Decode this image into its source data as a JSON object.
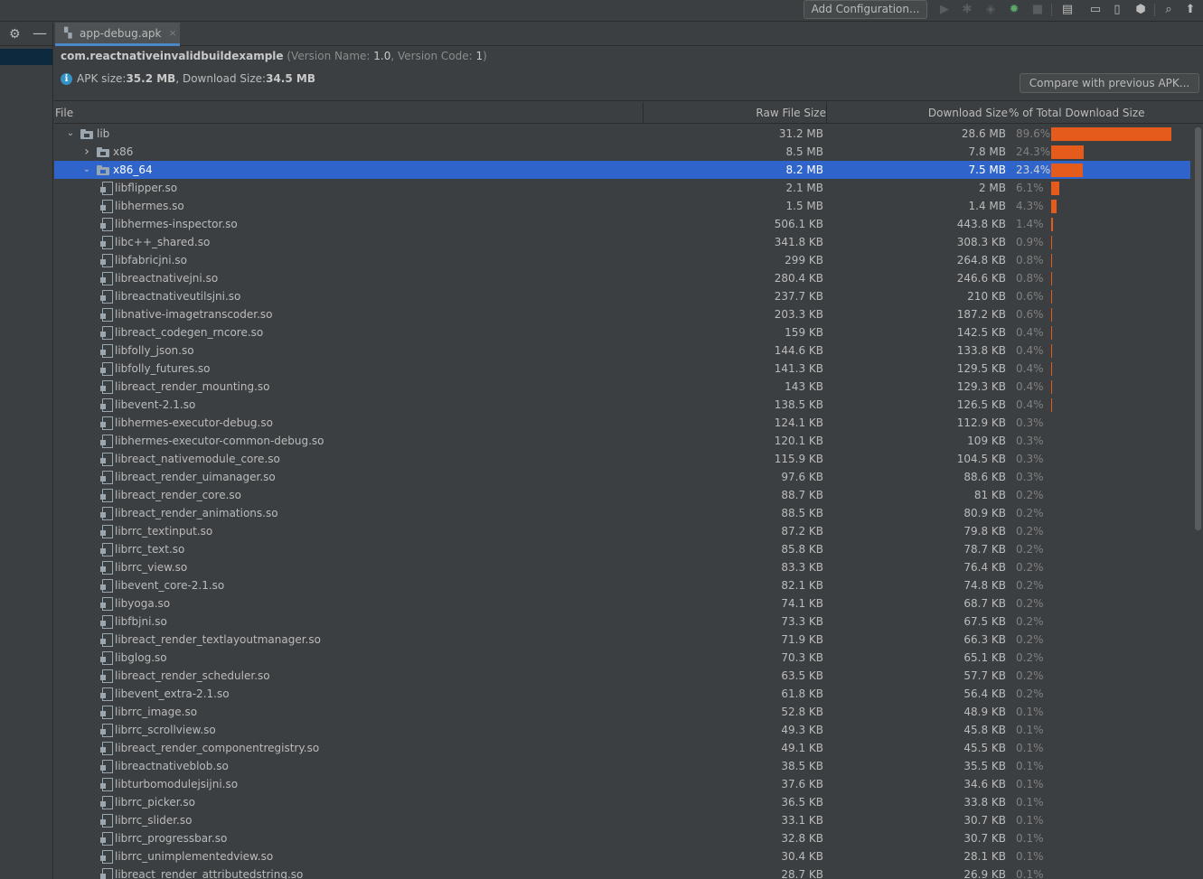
{
  "toolbar": {
    "add_configuration_label": "Add Configuration...",
    "icons": [
      "run-icon",
      "debug-icon",
      "coverage-icon",
      "profile-icon",
      "stop-icon",
      "project-structure-icon",
      "terminal-icon",
      "device-manager-icon",
      "sdk-manager-icon",
      "search-icon",
      "updates-icon"
    ]
  },
  "tab": {
    "label": "app-debug.apk",
    "close": "×"
  },
  "info": {
    "package_name": "com.reactnativeinvalidbuildexample",
    "version_prefix": "(Version Name: ",
    "version_name": "1.0",
    "version_mid": ", Version Code: ",
    "version_code": "1",
    "version_suffix": ")",
    "apk_size_label": "APK size: ",
    "apk_size": "35.2 MB",
    "download_size_label": ", Download Size: ",
    "download_size": "34.5 MB",
    "compare_button": "Compare with previous APK..."
  },
  "table": {
    "columns": {
      "file": "File",
      "raw_size": "Raw File Size",
      "download_size": "Download Size",
      "percent": "% of Total Download Size"
    },
    "rows": [
      {
        "name": "lib",
        "type": "folder",
        "level": 0,
        "expanded": true,
        "raw": "31.2 MB",
        "download": "28.6 MB",
        "percent": "89.6%",
        "fraction": 0.896
      },
      {
        "name": "x86",
        "type": "folder",
        "level": 1,
        "expanded": false,
        "raw": "8.5 MB",
        "download": "7.8 MB",
        "percent": "24.3%",
        "fraction": 0.243
      },
      {
        "name": "x86_64",
        "type": "folder",
        "level": 1,
        "expanded": true,
        "selected": true,
        "raw": "8.2 MB",
        "download": "7.5 MB",
        "percent": "23.4%",
        "fraction": 0.234
      },
      {
        "name": "libflipper.so",
        "type": "file",
        "level": 2,
        "raw": "2.1 MB",
        "download": "2 MB",
        "percent": "6.1%",
        "fraction": 0.061
      },
      {
        "name": "libhermes.so",
        "type": "file",
        "level": 2,
        "raw": "1.5 MB",
        "download": "1.4 MB",
        "percent": "4.3%",
        "fraction": 0.043
      },
      {
        "name": "libhermes-inspector.so",
        "type": "file",
        "level": 2,
        "raw": "506.1 KB",
        "download": "443.8 KB",
        "percent": "1.4%",
        "fraction": 0.014
      },
      {
        "name": "libc++_shared.so",
        "type": "file",
        "level": 2,
        "raw": "341.8 KB",
        "download": "308.3 KB",
        "percent": "0.9%",
        "fraction": 0.009
      },
      {
        "name": "libfabricjni.so",
        "type": "file",
        "level": 2,
        "raw": "299 KB",
        "download": "264.8 KB",
        "percent": "0.8%",
        "fraction": 0.008
      },
      {
        "name": "libreactnativejni.so",
        "type": "file",
        "level": 2,
        "raw": "280.4 KB",
        "download": "246.6 KB",
        "percent": "0.8%",
        "fraction": 0.008
      },
      {
        "name": "libreactnativeutilsjni.so",
        "type": "file",
        "level": 2,
        "raw": "237.7 KB",
        "download": "210 KB",
        "percent": "0.6%",
        "fraction": 0.006
      },
      {
        "name": "libnative-imagetranscoder.so",
        "type": "file",
        "level": 2,
        "raw": "203.3 KB",
        "download": "187.2 KB",
        "percent": "0.6%",
        "fraction": 0.006
      },
      {
        "name": "libreact_codegen_rncore.so",
        "type": "file",
        "level": 2,
        "raw": "159 KB",
        "download": "142.5 KB",
        "percent": "0.4%",
        "fraction": 0.004
      },
      {
        "name": "libfolly_json.so",
        "type": "file",
        "level": 2,
        "raw": "144.6 KB",
        "download": "133.8 KB",
        "percent": "0.4%",
        "fraction": 0.004
      },
      {
        "name": "libfolly_futures.so",
        "type": "file",
        "level": 2,
        "raw": "141.3 KB",
        "download": "129.5 KB",
        "percent": "0.4%",
        "fraction": 0.004
      },
      {
        "name": "libreact_render_mounting.so",
        "type": "file",
        "level": 2,
        "raw": "143 KB",
        "download": "129.3 KB",
        "percent": "0.4%",
        "fraction": 0.004
      },
      {
        "name": "libevent-2.1.so",
        "type": "file",
        "level": 2,
        "raw": "138.5 KB",
        "download": "126.5 KB",
        "percent": "0.4%",
        "fraction": 0.004
      },
      {
        "name": "libhermes-executor-debug.so",
        "type": "file",
        "level": 2,
        "raw": "124.1 KB",
        "download": "112.9 KB",
        "percent": "0.3%",
        "fraction": 0.003
      },
      {
        "name": "libhermes-executor-common-debug.so",
        "type": "file",
        "level": 2,
        "raw": "120.1 KB",
        "download": "109 KB",
        "percent": "0.3%",
        "fraction": 0.003
      },
      {
        "name": "libreact_nativemodule_core.so",
        "type": "file",
        "level": 2,
        "raw": "115.9 KB",
        "download": "104.5 KB",
        "percent": "0.3%",
        "fraction": 0.003
      },
      {
        "name": "libreact_render_uimanager.so",
        "type": "file",
        "level": 2,
        "raw": "97.6 KB",
        "download": "88.6 KB",
        "percent": "0.3%",
        "fraction": 0.003
      },
      {
        "name": "libreact_render_core.so",
        "type": "file",
        "level": 2,
        "raw": "88.7 KB",
        "download": "81 KB",
        "percent": "0.2%",
        "fraction": 0.002
      },
      {
        "name": "libreact_render_animations.so",
        "type": "file",
        "level": 2,
        "raw": "88.5 KB",
        "download": "80.9 KB",
        "percent": "0.2%",
        "fraction": 0.002
      },
      {
        "name": "librrc_textinput.so",
        "type": "file",
        "level": 2,
        "raw": "87.2 KB",
        "download": "79.8 KB",
        "percent": "0.2%",
        "fraction": 0.002
      },
      {
        "name": "librrc_text.so",
        "type": "file",
        "level": 2,
        "raw": "85.8 KB",
        "download": "78.7 KB",
        "percent": "0.2%",
        "fraction": 0.002
      },
      {
        "name": "librrc_view.so",
        "type": "file",
        "level": 2,
        "raw": "83.3 KB",
        "download": "76.4 KB",
        "percent": "0.2%",
        "fraction": 0.002
      },
      {
        "name": "libevent_core-2.1.so",
        "type": "file",
        "level": 2,
        "raw": "82.1 KB",
        "download": "74.8 KB",
        "percent": "0.2%",
        "fraction": 0.002
      },
      {
        "name": "libyoga.so",
        "type": "file",
        "level": 2,
        "raw": "74.1 KB",
        "download": "68.7 KB",
        "percent": "0.2%",
        "fraction": 0.002
      },
      {
        "name": "libfbjni.so",
        "type": "file",
        "level": 2,
        "raw": "73.3 KB",
        "download": "67.5 KB",
        "percent": "0.2%",
        "fraction": 0.002
      },
      {
        "name": "libreact_render_textlayoutmanager.so",
        "type": "file",
        "level": 2,
        "raw": "71.9 KB",
        "download": "66.3 KB",
        "percent": "0.2%",
        "fraction": 0.002
      },
      {
        "name": "libglog.so",
        "type": "file",
        "level": 2,
        "raw": "70.3 KB",
        "download": "65.1 KB",
        "percent": "0.2%",
        "fraction": 0.002
      },
      {
        "name": "libreact_render_scheduler.so",
        "type": "file",
        "level": 2,
        "raw": "63.5 KB",
        "download": "57.7 KB",
        "percent": "0.2%",
        "fraction": 0.002
      },
      {
        "name": "libevent_extra-2.1.so",
        "type": "file",
        "level": 2,
        "raw": "61.8 KB",
        "download": "56.4 KB",
        "percent": "0.2%",
        "fraction": 0.002
      },
      {
        "name": "librrc_image.so",
        "type": "file",
        "level": 2,
        "raw": "52.8 KB",
        "download": "48.9 KB",
        "percent": "0.1%",
        "fraction": 0.001
      },
      {
        "name": "librrc_scrollview.so",
        "type": "file",
        "level": 2,
        "raw": "49.3 KB",
        "download": "45.8 KB",
        "percent": "0.1%",
        "fraction": 0.001
      },
      {
        "name": "libreact_render_componentregistry.so",
        "type": "file",
        "level": 2,
        "raw": "49.1 KB",
        "download": "45.5 KB",
        "percent": "0.1%",
        "fraction": 0.001
      },
      {
        "name": "libreactnativeblob.so",
        "type": "file",
        "level": 2,
        "raw": "38.5 KB",
        "download": "35.5 KB",
        "percent": "0.1%",
        "fraction": 0.001
      },
      {
        "name": "libturbomodulejsijni.so",
        "type": "file",
        "level": 2,
        "raw": "37.6 KB",
        "download": "34.6 KB",
        "percent": "0.1%",
        "fraction": 0.001
      },
      {
        "name": "librrc_picker.so",
        "type": "file",
        "level": 2,
        "raw": "36.5 KB",
        "download": "33.8 KB",
        "percent": "0.1%",
        "fraction": 0.001
      },
      {
        "name": "librrc_slider.so",
        "type": "file",
        "level": 2,
        "raw": "33.1 KB",
        "download": "30.7 KB",
        "percent": "0.1%",
        "fraction": 0.001
      },
      {
        "name": "librrc_progressbar.so",
        "type": "file",
        "level": 2,
        "raw": "32.8 KB",
        "download": "30.7 KB",
        "percent": "0.1%",
        "fraction": 0.001
      },
      {
        "name": "librrc_unimplementedview.so",
        "type": "file",
        "level": 2,
        "raw": "30.4 KB",
        "download": "28.1 KB",
        "percent": "0.1%",
        "fraction": 0.001
      },
      {
        "name": "libreact_render_attributedstring.so",
        "type": "file",
        "level": 2,
        "raw": "28.7 KB",
        "download": "26.9 KB",
        "percent": "0.1%",
        "fraction": 0.001
      }
    ]
  },
  "colors": {
    "bar": "#e55b1b",
    "selection": "#2f65ca",
    "background": "#3c3f41"
  }
}
